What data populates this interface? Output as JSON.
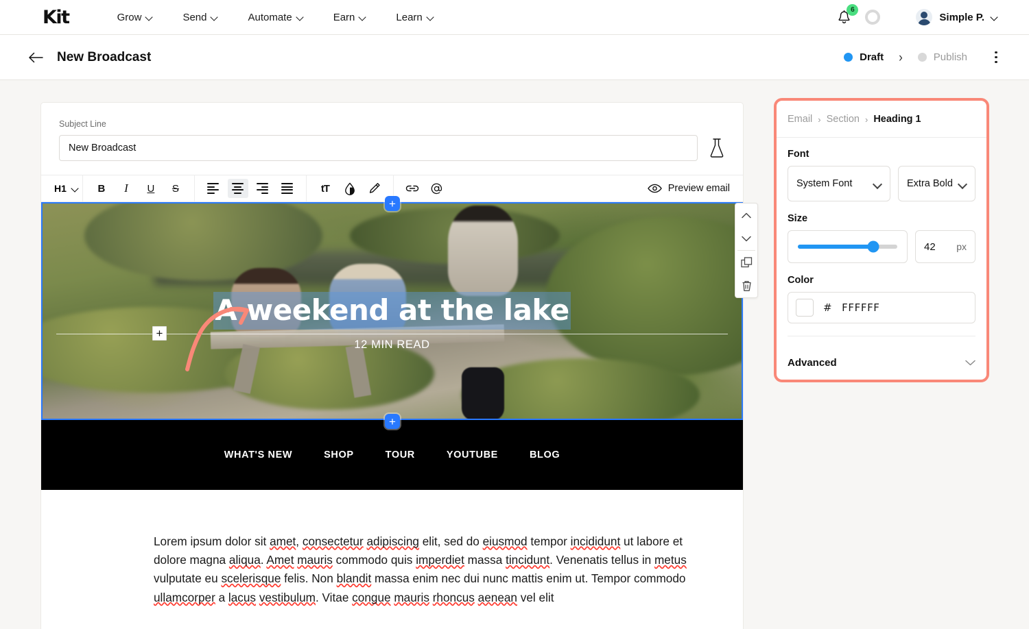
{
  "topnav": {
    "logo": "Kit",
    "items": [
      {
        "label": "Grow",
        "icon": "chevron-down-icon"
      },
      {
        "label": "Send",
        "icon": "chevron-down-icon"
      },
      {
        "label": "Automate",
        "icon": "chevron-down-icon"
      },
      {
        "label": "Earn",
        "icon": "chevron-down-icon"
      },
      {
        "label": "Learn",
        "icon": "chevron-down-icon"
      }
    ],
    "notification_badge": "6",
    "notification_badge_color": "#4ade80",
    "bell_icon": "bell-icon",
    "progress_ring_icon": "progress-ring-icon",
    "user_name": "Simple P.",
    "user_chevron": "chevron-down-icon"
  },
  "subheader": {
    "back_icon": "arrow-left-icon",
    "title": "New Broadcast",
    "steps": [
      {
        "label": "Draft",
        "state": "active",
        "dot_color": "#2196f3"
      },
      {
        "label": "Publish",
        "state": "inactive",
        "dot_color": "#d8d8d8"
      }
    ],
    "separator": "›",
    "more_icon": "kebab-menu-icon"
  },
  "editor": {
    "subject_label": "Subject Line",
    "subject_value": "New Broadcast",
    "subject_placeholder": "Subject Line",
    "ab_test_icon": "flask-icon",
    "toolbar": {
      "block_type": "H1",
      "block_chevron": "chevron-down-icon",
      "bold": "B",
      "italic": "I",
      "underline": "U",
      "strikethrough": "S",
      "align_left": "align-left-icon",
      "align_center": "align-center-icon",
      "align_right": "align-right-icon",
      "align_justify": "align-justify-icon",
      "text_size": "tT",
      "text_color": "color-drop-icon",
      "highlight": "highlighter-icon",
      "link": "link-icon",
      "mention": "at-mention-icon",
      "preview_label": "Preview email",
      "preview_icon": "eye-icon",
      "active_align": "align-center-icon"
    }
  },
  "email": {
    "hero": {
      "heading": "A weekend at the lake",
      "subheading": "12 MIN READ",
      "heading_color": "#FFFFFF",
      "selection_highlight": "#5a96dc",
      "add_block_top": "+",
      "add_block_bottom": "+",
      "add_inline": "+"
    },
    "nav_links": [
      "WHAT'S NEW",
      "SHOP",
      "TOUR",
      "YOUTUBE",
      "BLOG"
    ],
    "nav_background": "#000000",
    "body_paragraph": "Lorem ipsum dolor sit amet, consectetur adipiscing elit, sed do eiusmod tempor incididunt ut labore et dolore magna aliqua. Amet mauris commodo quis imperdiet massa tincidunt. Venenatis tellus in metus vulputate eu scelerisque felis. Non blandit massa enim nec dui nunc mattis enim ut. Tempor commodo ullamcorper a lacus vestibulum. Vitae congue mauris rhoncus aenean vel elit"
  },
  "block_tools": {
    "move_up": "chevron-up-icon",
    "move_down": "chevron-down-icon",
    "duplicate": "duplicate-icon",
    "delete": "trash-icon"
  },
  "panel": {
    "border_color": "#f98878",
    "breadcrumb": {
      "root": "Email",
      "middle": "Section",
      "current": "Heading 1",
      "separator": "›"
    },
    "font": {
      "label": "Font",
      "family_value": "System Font",
      "weight_value": "Extra Bold",
      "chevron": "chevron-down-icon"
    },
    "size": {
      "label": "Size",
      "value": "42",
      "unit": "px",
      "slider_percent": 76,
      "slider_color": "#2196f3"
    },
    "color": {
      "label": "Color",
      "hash": "#",
      "value": "FFFFFF",
      "swatch": "#FFFFFF"
    },
    "advanced": {
      "label": "Advanced",
      "chevron": "chevron-down-icon"
    }
  }
}
